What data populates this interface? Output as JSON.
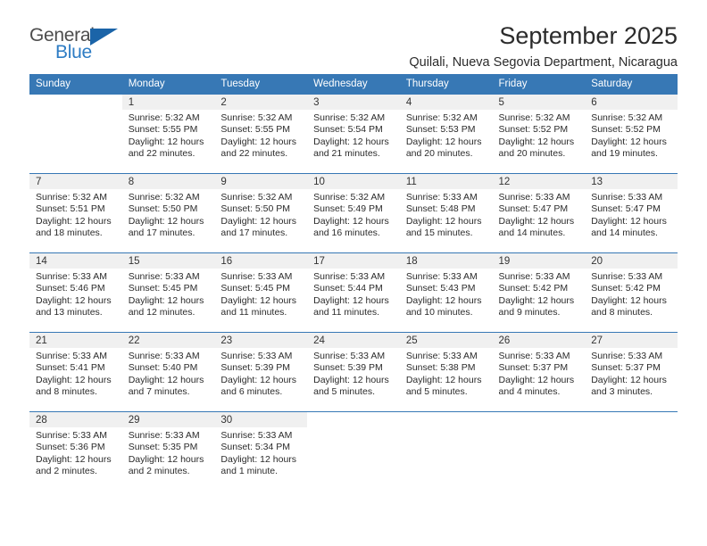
{
  "logo": {
    "word_top": "General",
    "word_bottom": "Blue",
    "triangle_icon": "triangle-icon"
  },
  "header": {
    "title": "September 2025",
    "subtitle": "Quilali, Nueva Segovia Department, Nicaragua"
  },
  "colors": {
    "header_blue": "#3778b5",
    "logo_blue": "#2d7cc4",
    "daynum_bg": "#f0f0f0",
    "text": "#2b2b2b"
  },
  "weekday_headers": [
    "Sunday",
    "Monday",
    "Tuesday",
    "Wednesday",
    "Thursday",
    "Friday",
    "Saturday"
  ],
  "weeks": [
    [
      {
        "day": "",
        "blank": true
      },
      {
        "day": "1",
        "sunrise": "Sunrise: 5:32 AM",
        "sunset": "Sunset: 5:55 PM",
        "daylight": "Daylight: 12 hours and 22 minutes."
      },
      {
        "day": "2",
        "sunrise": "Sunrise: 5:32 AM",
        "sunset": "Sunset: 5:55 PM",
        "daylight": "Daylight: 12 hours and 22 minutes."
      },
      {
        "day": "3",
        "sunrise": "Sunrise: 5:32 AM",
        "sunset": "Sunset: 5:54 PM",
        "daylight": "Daylight: 12 hours and 21 minutes."
      },
      {
        "day": "4",
        "sunrise": "Sunrise: 5:32 AM",
        "sunset": "Sunset: 5:53 PM",
        "daylight": "Daylight: 12 hours and 20 minutes."
      },
      {
        "day": "5",
        "sunrise": "Sunrise: 5:32 AM",
        "sunset": "Sunset: 5:52 PM",
        "daylight": "Daylight: 12 hours and 20 minutes."
      },
      {
        "day": "6",
        "sunrise": "Sunrise: 5:32 AM",
        "sunset": "Sunset: 5:52 PM",
        "daylight": "Daylight: 12 hours and 19 minutes."
      }
    ],
    [
      {
        "day": "7",
        "sunrise": "Sunrise: 5:32 AM",
        "sunset": "Sunset: 5:51 PM",
        "daylight": "Daylight: 12 hours and 18 minutes."
      },
      {
        "day": "8",
        "sunrise": "Sunrise: 5:32 AM",
        "sunset": "Sunset: 5:50 PM",
        "daylight": "Daylight: 12 hours and 17 minutes."
      },
      {
        "day": "9",
        "sunrise": "Sunrise: 5:32 AM",
        "sunset": "Sunset: 5:50 PM",
        "daylight": "Daylight: 12 hours and 17 minutes."
      },
      {
        "day": "10",
        "sunrise": "Sunrise: 5:32 AM",
        "sunset": "Sunset: 5:49 PM",
        "daylight": "Daylight: 12 hours and 16 minutes."
      },
      {
        "day": "11",
        "sunrise": "Sunrise: 5:33 AM",
        "sunset": "Sunset: 5:48 PM",
        "daylight": "Daylight: 12 hours and 15 minutes."
      },
      {
        "day": "12",
        "sunrise": "Sunrise: 5:33 AM",
        "sunset": "Sunset: 5:47 PM",
        "daylight": "Daylight: 12 hours and 14 minutes."
      },
      {
        "day": "13",
        "sunrise": "Sunrise: 5:33 AM",
        "sunset": "Sunset: 5:47 PM",
        "daylight": "Daylight: 12 hours and 14 minutes."
      }
    ],
    [
      {
        "day": "14",
        "sunrise": "Sunrise: 5:33 AM",
        "sunset": "Sunset: 5:46 PM",
        "daylight": "Daylight: 12 hours and 13 minutes."
      },
      {
        "day": "15",
        "sunrise": "Sunrise: 5:33 AM",
        "sunset": "Sunset: 5:45 PM",
        "daylight": "Daylight: 12 hours and 12 minutes."
      },
      {
        "day": "16",
        "sunrise": "Sunrise: 5:33 AM",
        "sunset": "Sunset: 5:45 PM",
        "daylight": "Daylight: 12 hours and 11 minutes."
      },
      {
        "day": "17",
        "sunrise": "Sunrise: 5:33 AM",
        "sunset": "Sunset: 5:44 PM",
        "daylight": "Daylight: 12 hours and 11 minutes."
      },
      {
        "day": "18",
        "sunrise": "Sunrise: 5:33 AM",
        "sunset": "Sunset: 5:43 PM",
        "daylight": "Daylight: 12 hours and 10 minutes."
      },
      {
        "day": "19",
        "sunrise": "Sunrise: 5:33 AM",
        "sunset": "Sunset: 5:42 PM",
        "daylight": "Daylight: 12 hours and 9 minutes."
      },
      {
        "day": "20",
        "sunrise": "Sunrise: 5:33 AM",
        "sunset": "Sunset: 5:42 PM",
        "daylight": "Daylight: 12 hours and 8 minutes."
      }
    ],
    [
      {
        "day": "21",
        "sunrise": "Sunrise: 5:33 AM",
        "sunset": "Sunset: 5:41 PM",
        "daylight": "Daylight: 12 hours and 8 minutes."
      },
      {
        "day": "22",
        "sunrise": "Sunrise: 5:33 AM",
        "sunset": "Sunset: 5:40 PM",
        "daylight": "Daylight: 12 hours and 7 minutes."
      },
      {
        "day": "23",
        "sunrise": "Sunrise: 5:33 AM",
        "sunset": "Sunset: 5:39 PM",
        "daylight": "Daylight: 12 hours and 6 minutes."
      },
      {
        "day": "24",
        "sunrise": "Sunrise: 5:33 AM",
        "sunset": "Sunset: 5:39 PM",
        "daylight": "Daylight: 12 hours and 5 minutes."
      },
      {
        "day": "25",
        "sunrise": "Sunrise: 5:33 AM",
        "sunset": "Sunset: 5:38 PM",
        "daylight": "Daylight: 12 hours and 5 minutes."
      },
      {
        "day": "26",
        "sunrise": "Sunrise: 5:33 AM",
        "sunset": "Sunset: 5:37 PM",
        "daylight": "Daylight: 12 hours and 4 minutes."
      },
      {
        "day": "27",
        "sunrise": "Sunrise: 5:33 AM",
        "sunset": "Sunset: 5:37 PM",
        "daylight": "Daylight: 12 hours and 3 minutes."
      }
    ],
    [
      {
        "day": "28",
        "sunrise": "Sunrise: 5:33 AM",
        "sunset": "Sunset: 5:36 PM",
        "daylight": "Daylight: 12 hours and 2 minutes."
      },
      {
        "day": "29",
        "sunrise": "Sunrise: 5:33 AM",
        "sunset": "Sunset: 5:35 PM",
        "daylight": "Daylight: 12 hours and 2 minutes."
      },
      {
        "day": "30",
        "sunrise": "Sunrise: 5:33 AM",
        "sunset": "Sunset: 5:34 PM",
        "daylight": "Daylight: 12 hours and 1 minute."
      },
      {
        "day": "",
        "blank": true
      },
      {
        "day": "",
        "blank": true
      },
      {
        "day": "",
        "blank": true
      },
      {
        "day": "",
        "blank": true
      }
    ]
  ]
}
